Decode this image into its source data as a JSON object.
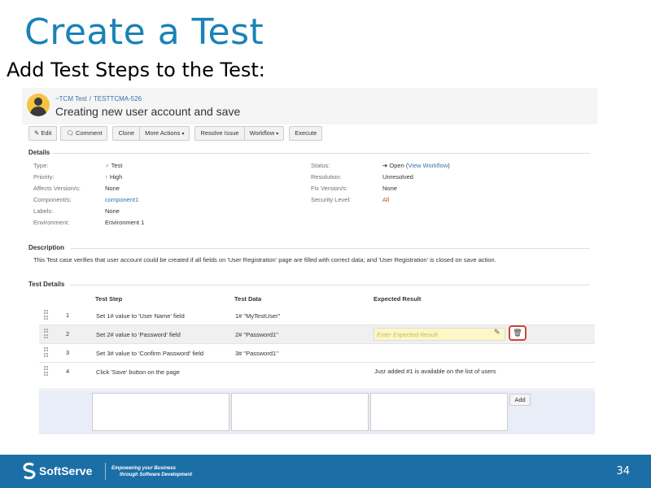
{
  "slide": {
    "title": "Create a Test",
    "subtitle": "Add Test Steps to the Test:",
    "page_number": "34"
  },
  "issue": {
    "breadcrumb_project": "~TCM Test",
    "breadcrumb_sep": "/",
    "breadcrumb_key": "TESTTCMA-526",
    "title": "Creating new user account and save"
  },
  "toolbar": {
    "edit": "Edit",
    "comment": "Comment",
    "clone": "Clone",
    "more_actions": "More Actions",
    "resolve_issue": "Resolve Issue",
    "workflow": "Workflow",
    "execute": "Execute"
  },
  "details": {
    "heading": "Details",
    "type_label": "Type:",
    "type_value": "Test",
    "priority_label": "Priority:",
    "priority_value": "High",
    "affects_label": "Affects Version/s:",
    "affects_value": "None",
    "components_label": "Component/s:",
    "components_value": "component1",
    "labels_label": "Labels:",
    "labels_value": "None",
    "environment_label": "Environment:",
    "environment_value": "Environment 1",
    "status_label": "Status:",
    "status_value": "Open",
    "status_open_paren": "(",
    "status_link": "View Workflow",
    "status_close_paren": ")",
    "resolution_label": "Resolution:",
    "resolution_value": "Unresolved",
    "fix_label": "Fix Version/s:",
    "fix_value": "None",
    "security_label": "Security Level:",
    "security_value": "All"
  },
  "description": {
    "heading": "Description",
    "text": "This Test case verifies that user account could be created if all fields on 'User Registration' page are filled with correct data; and 'User Registration' is closed on save action."
  },
  "test_details": {
    "heading": "Test Details",
    "columns": [
      "Test Step",
      "Test Data",
      "Expected Result"
    ],
    "rows": [
      {
        "num": "1",
        "step": "Set 1# value to 'User Name' field",
        "data": "1# \"MyTestUser\"",
        "expected": ""
      },
      {
        "num": "2",
        "step": "Set 2# value to 'Password' field",
        "data": "2# \"Password1\"",
        "expected": ""
      },
      {
        "num": "3",
        "step": "Set 3# value to 'Confirm Password' field",
        "data": "3# \"Password1\"",
        "expected": ""
      },
      {
        "num": "4",
        "step": "Click 'Save' button on the page",
        "data": "",
        "expected": "Jusr added #1 is available on the list of users"
      }
    ],
    "expected_placeholder": "Enter Expected Result",
    "add_label": "Add"
  },
  "footer": {
    "brand": "SoftServe",
    "tagline_1": "Empowering your Business",
    "tagline_2": "through Software Development"
  },
  "colors": {
    "title_blue": "#1b82b6",
    "link_blue": "#3572b0",
    "footer_blue": "#1b6fa6",
    "alert_red": "#d04437"
  }
}
